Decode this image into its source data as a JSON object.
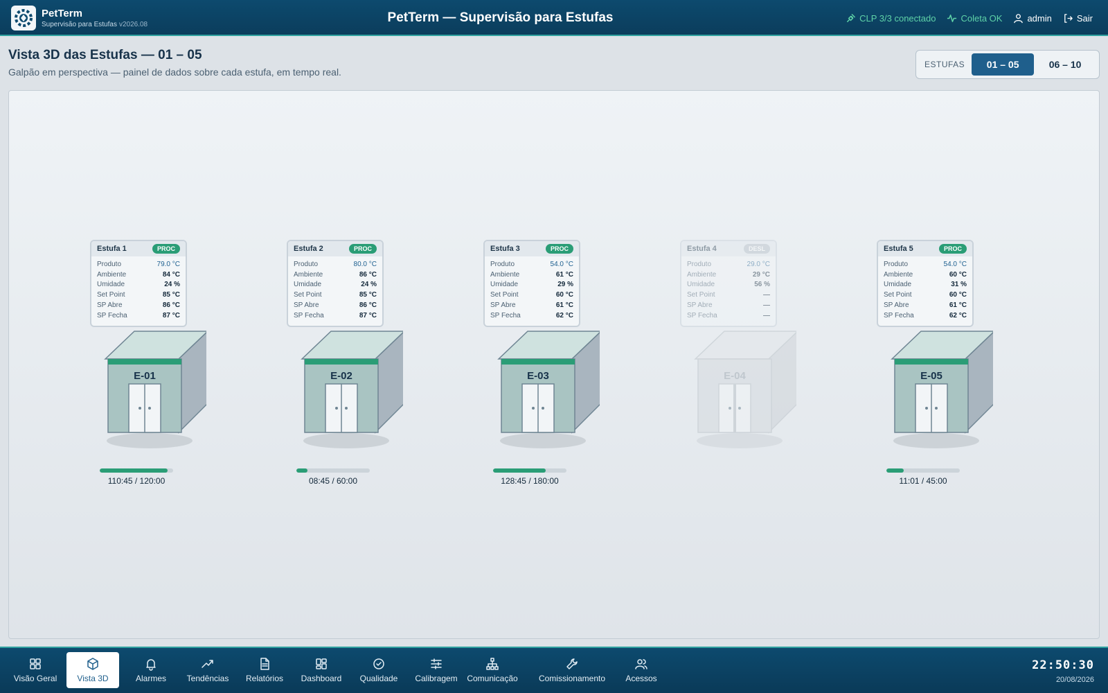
{
  "header": {
    "brand": "PetTerm",
    "brand_sub": "Supervisão para Estufas",
    "version": "v2026.08",
    "title": "PetTerm — Supervisão para Estufas",
    "clp_status": "CLP 3/3 conectado",
    "coleta_status": "Coleta OK",
    "user": "admin",
    "logout": "Sair"
  },
  "page": {
    "title": "Vista 3D das Estufas — 01 – 05",
    "subtitle": "Galpão em perspectiva — painel de dados sobre cada estufa, em tempo real.",
    "group_label": "ESTUFAS",
    "groups": [
      "01 – 05",
      "06 – 10"
    ]
  },
  "labels": {
    "produto": "Produto",
    "ambiente": "Ambiente",
    "umidade": "Umidade",
    "setpoint": "Set Point",
    "sp_abre": "SP Abre",
    "sp_fecha": "SP Fecha"
  },
  "estufas": [
    {
      "name": "Estufa 1",
      "status": "PROC",
      "code": "E-01",
      "produto": "79.0 °C",
      "ambiente": "84 °C",
      "umidade": "24 %",
      "setpoint": "85 °C",
      "sp_abre": "86 °C",
      "sp_fecha": "87 °C",
      "time": "110:45 / 120:00",
      "progress": 0.92
    },
    {
      "name": "Estufa 2",
      "status": "PROC",
      "code": "E-02",
      "produto": "80.0 °C",
      "ambiente": "86 °C",
      "umidade": "24 %",
      "setpoint": "85 °C",
      "sp_abre": "86 °C",
      "sp_fecha": "87 °C",
      "time": "08:45 / 60:00",
      "progress": 0.15
    },
    {
      "name": "Estufa 3",
      "status": "PROC",
      "code": "E-03",
      "produto": "54.0 °C",
      "ambiente": "61 °C",
      "umidade": "29 %",
      "setpoint": "60 °C",
      "sp_abre": "61 °C",
      "sp_fecha": "62 °C",
      "time": "128:45 / 180:00",
      "progress": 0.72
    },
    {
      "name": "Estufa 4",
      "status": "DESL",
      "code": "E-04",
      "produto": "29.0 °C",
      "ambiente": "29 °C",
      "umidade": "56 %",
      "setpoint": "—",
      "sp_abre": "—",
      "sp_fecha": "—",
      "time": "",
      "progress": null
    },
    {
      "name": "Estufa 5",
      "status": "PROC",
      "code": "E-05",
      "produto": "54.0 °C",
      "ambiente": "60 °C",
      "umidade": "31 %",
      "setpoint": "60 °C",
      "sp_abre": "61 °C",
      "sp_fecha": "62 °C",
      "time": "11:01 / 45:00",
      "progress": 0.24
    }
  ],
  "nav": [
    {
      "label": "Visão Geral",
      "icon": "grid-icon"
    },
    {
      "label": "Vista 3D",
      "icon": "cube-icon",
      "active": true
    },
    {
      "label": "Alarmes",
      "icon": "bell-icon"
    },
    {
      "label": "Tendências",
      "icon": "trend-icon"
    },
    {
      "label": "Relatórios",
      "icon": "document-icon"
    },
    {
      "label": "Dashboard",
      "icon": "dashboard-icon"
    },
    {
      "label": "Qualidade",
      "icon": "check-circle-icon"
    },
    {
      "label": "Calibragem",
      "icon": "sliders-icon"
    },
    {
      "label": "Comunicação",
      "icon": "network-icon"
    },
    {
      "label": "Comissionamento",
      "icon": "wrench-icon"
    },
    {
      "label": "Acessos",
      "icon": "users-icon"
    }
  ],
  "clock": {
    "time": "22:50:30",
    "date": "20/08/2026"
  },
  "colors": {
    "accent": "#2a9d76",
    "header": "#0d4a6e",
    "active_tab": "#1f5f8c",
    "produto_value": "#1f6090"
  }
}
